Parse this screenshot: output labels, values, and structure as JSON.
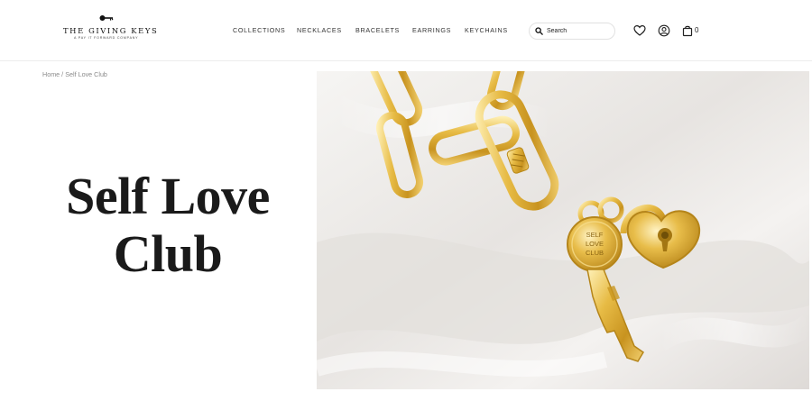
{
  "brand": {
    "title": "THE GIVING KEYS",
    "tagline": "A PAY IT FORWARD COMPANY"
  },
  "nav": {
    "items": [
      {
        "label": "COLLECTIONS"
      },
      {
        "label": "NECKLACES"
      },
      {
        "label": "BRACELETS"
      },
      {
        "label": "EARRINGS"
      },
      {
        "label": "KEYCHAINS"
      }
    ]
  },
  "search": {
    "placeholder": "Search"
  },
  "cart": {
    "count": "0"
  },
  "icons": {
    "search": "search-icon",
    "wishlist": "heart-icon",
    "account": "user-icon",
    "cart": "shopping-bag-icon",
    "logo": "key-icon"
  },
  "breadcrumb": {
    "home": "Home",
    "separator": " / ",
    "current": "Self Love Club"
  },
  "hero": {
    "title_line1": "Self Love",
    "title_line2": "Club",
    "key_engraving_1": "SELF",
    "key_engraving_2": "LOVE",
    "key_engraving_3": "CLUB"
  },
  "colors": {
    "gold": "#e2b53f",
    "gold_dark": "#b58418",
    "background": "#ffffff",
    "satin": "#efedeb"
  }
}
